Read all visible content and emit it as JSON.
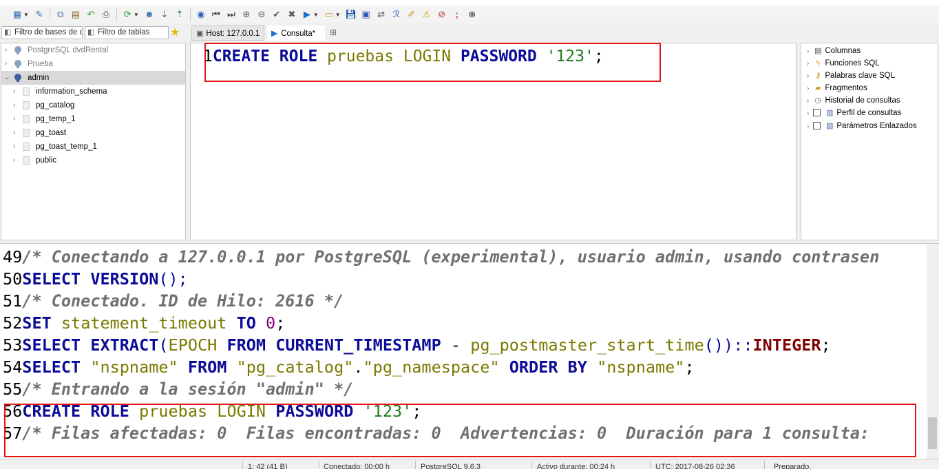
{
  "toolbar": {
    "icons": [
      "manage-sessions-icon",
      "connect-icon",
      "copy-icon",
      "paste-icon",
      "undo-icon",
      "print-icon",
      "refresh-icon",
      "users-icon",
      "import-icon",
      "export-icon",
      "help-icon",
      "first-icon",
      "last-icon",
      "add-icon",
      "remove-icon",
      "apply-icon",
      "cancel-icon",
      "run-icon",
      "new-query-icon",
      "save-icon",
      "find-icon",
      "replace-icon",
      "format-icon",
      "warning-icon",
      "clear-icon",
      "semicolon-icon",
      "stop-icon"
    ]
  },
  "filters": {
    "db_filter_placeholder": "Filtro de bases de d",
    "table_filter_placeholder": "Filtro de tablas"
  },
  "tabs": [
    {
      "label": "Host: 127.0.0.1"
    },
    {
      "label": "Consulta*"
    }
  ],
  "tree": [
    {
      "label": "PostgreSQL dvdRental"
    },
    {
      "label": "Prueba"
    },
    {
      "label": "admin"
    },
    {
      "label": "information_schema"
    },
    {
      "label": "pg_catalog"
    },
    {
      "label": "pg_temp_1"
    },
    {
      "label": "pg_toast"
    },
    {
      "label": "pg_toast_temp_1"
    },
    {
      "label": "public"
    }
  ],
  "editor": {
    "line_number": "1",
    "tokens": [
      "CREATE ROLE",
      " ",
      "pruebas",
      " ",
      "LOGIN",
      " ",
      "PASSWORD",
      " ",
      "'123'",
      ";"
    ]
  },
  "helpers": [
    {
      "label": "Columnas"
    },
    {
      "label": "Funciones SQL"
    },
    {
      "label": "Palabras clave SQL"
    },
    {
      "label": "Fragmentos"
    },
    {
      "label": "Historial de consultas"
    },
    {
      "label": "Perfil de consultas"
    },
    {
      "label": "Parámetros Enlazados"
    }
  ],
  "log": [
    {
      "n": "49",
      "parts": [
        "/* Conectando a 127.0.0.1 por PostgreSQL (experimental), usuario admin, usando contrasen"
      ]
    },
    {
      "n": "50",
      "parts": [
        "SELECT",
        " ",
        "VERSION",
        "();"
      ]
    },
    {
      "n": "51",
      "parts": [
        "/* Conectado. ID de Hilo: 2616 */"
      ]
    },
    {
      "n": "52",
      "parts": [
        "SET",
        " ",
        "statement_timeout",
        " ",
        "TO",
        " ",
        "0",
        ";"
      ]
    },
    {
      "n": "53",
      "parts": [
        "SELECT",
        " ",
        "EXTRACT",
        "(",
        "EPOCH",
        " ",
        "FROM",
        " ",
        "CURRENT_TIMESTAMP",
        " - ",
        "pg_postmaster_start_time",
        "())::",
        "INTEGER",
        ";"
      ]
    },
    {
      "n": "54",
      "parts": [
        "SELECT",
        " ",
        "\"nspname\"",
        " ",
        "FROM",
        " ",
        "\"pg_catalog\"",
        ".",
        "\"pg_namespace\"",
        " ",
        "ORDER BY",
        " ",
        "\"nspname\"",
        ";"
      ]
    },
    {
      "n": "55",
      "parts": [
        "/* Entrando a la sesión \"admin\" */"
      ]
    },
    {
      "n": "56",
      "parts": [
        "CREATE ROLE",
        " ",
        "pruebas",
        " ",
        "LOGIN",
        " ",
        "PASSWORD",
        " ",
        "'123'",
        ";"
      ]
    },
    {
      "n": "57",
      "parts": [
        "/* Filas afectadas: 0  Filas encontradas: 0  Advertencias: 0  Duración para 1 consulta:"
      ]
    }
  ],
  "status": [
    {
      "text": "1: 42 (41 B)"
    },
    {
      "text": "Conectado: 00:00 h"
    },
    {
      "text": "PostgreSQL 9.6.3"
    },
    {
      "text": "Activo durante: 00:24 h"
    },
    {
      "text": "UTC: 2017-08-26 02:36"
    },
    {
      "text": "Preparado."
    }
  ],
  "colors": {
    "keyword": "#0b0b99",
    "identifier": "#7a7a00",
    "string": "#1e7b1e",
    "number": "#800080",
    "comment": "#707070",
    "type": "#800000",
    "highlight": "#e41515"
  }
}
